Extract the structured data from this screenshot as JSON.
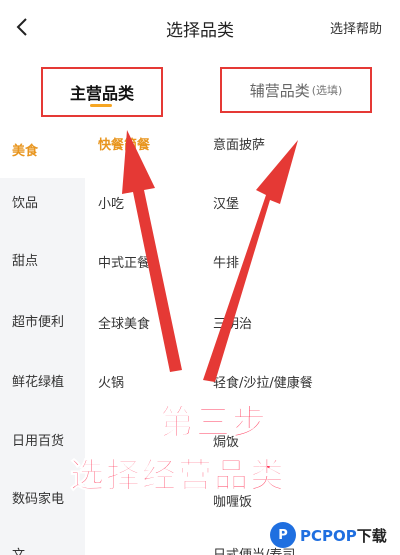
{
  "header": {
    "title": "选择品类",
    "help_label": "选择帮助"
  },
  "tabs": {
    "main_label": "主营品类",
    "sub_label": "辅营品类",
    "sub_note": "(选填)"
  },
  "sidebar": {
    "items": [
      {
        "label": "美食",
        "active": true
      },
      {
        "label": "饮品"
      },
      {
        "label": "甜点"
      },
      {
        "label": "超市便利"
      },
      {
        "label": "鲜花绿植"
      },
      {
        "label": "日用百货"
      },
      {
        "label": "数码家电"
      },
      {
        "label": "文..."
      }
    ]
  },
  "content": {
    "col1": [
      "快餐简餐",
      "小吃",
      "中式正餐",
      "全球美食",
      "火锅"
    ],
    "col2": [
      "意面披萨",
      "汉堡",
      "牛排",
      "三明治",
      "轻食/沙拉/健康餐",
      "焗饭",
      "咖喱饭",
      "日式便当/寿司"
    ]
  },
  "overlay": {
    "step": "第三步",
    "desc": "选择经营品类",
    "color": "#ff3b5c",
    "arrow_color": "#e53935"
  },
  "watermark": {
    "logo": "P",
    "brand": "PCPOP",
    "suffix": "下载"
  },
  "colors": {
    "accent": "#e8951e",
    "highlight_box": "#e53935"
  }
}
